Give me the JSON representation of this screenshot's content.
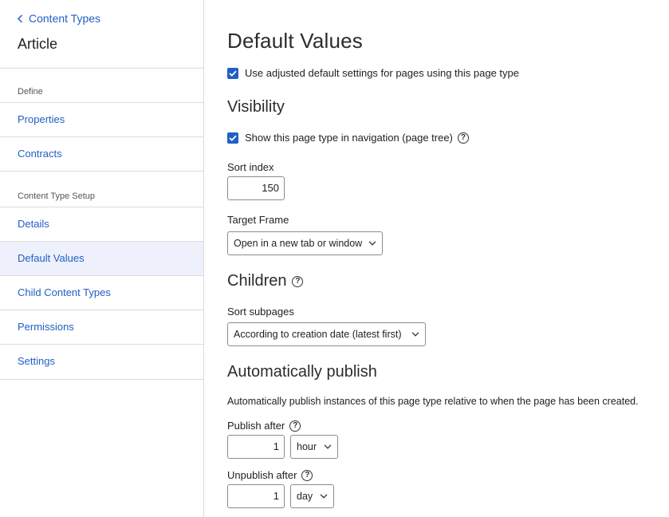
{
  "sidebar": {
    "back_label": "Content Types",
    "title": "Article",
    "sections": {
      "define": "Define",
      "setup": "Content Type Setup"
    },
    "items": {
      "properties": "Properties",
      "contracts": "Contracts",
      "details": "Details",
      "default_values": "Default Values",
      "child_content_types": "Child Content Types",
      "permissions": "Permissions",
      "settings": "Settings"
    },
    "active_item": "Default Values"
  },
  "main": {
    "title": "Default Values",
    "use_adjusted": {
      "label": "Use adjusted default settings for pages using this page type",
      "checked": true
    },
    "visibility": {
      "heading": "Visibility",
      "show_in_nav": {
        "label": "Show this page type in navigation (page tree)",
        "checked": true
      },
      "sort_index_label": "Sort index",
      "sort_index_value": "150",
      "target_frame_label": "Target Frame",
      "target_frame_value": "Open in a new tab or window"
    },
    "children": {
      "heading": "Children",
      "sort_subpages_label": "Sort subpages",
      "sort_subpages_value": "According to creation date (latest first)"
    },
    "auto_publish": {
      "heading": "Automatically publish",
      "description": "Automatically publish instances of this page type relative to when the page has been created.",
      "publish_after_label": "Publish after",
      "publish_after_value": "1",
      "publish_after_unit": "hour",
      "unpublish_after_label": "Unpublish after",
      "unpublish_after_value": "1",
      "unpublish_after_unit": "day"
    }
  },
  "colors": {
    "accent": "#2160c4",
    "active_bg": "#eef1fb",
    "divider": "#dcdcdc"
  }
}
